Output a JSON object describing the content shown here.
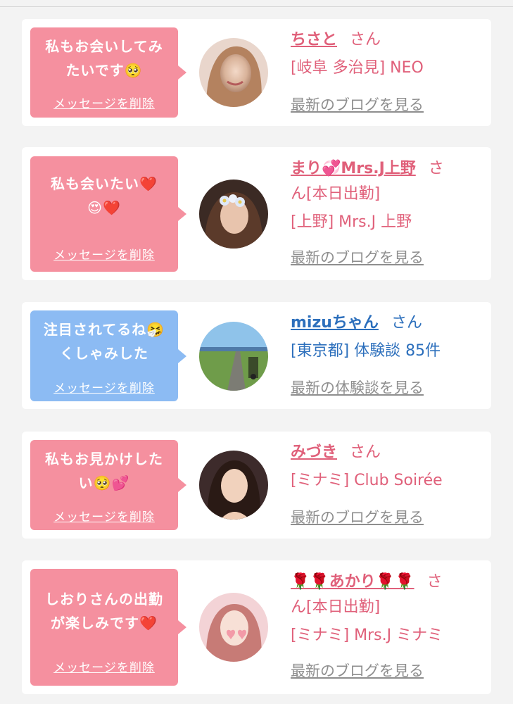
{
  "cards": [
    {
      "bubble_text": "私もお会いしてみ\nたいです🥺",
      "delete_label": "メッセージを削除",
      "name": "ちさと",
      "honorific": "さん",
      "name_suffix": "",
      "details": [
        "[岐阜 多治見] NEO"
      ],
      "link_label": "最新のブログを見る",
      "theme": "pink",
      "avatar_icon": "woman-portrait-avatar"
    },
    {
      "bubble_text": "私も会いたい❤️\n😍❤️",
      "delete_label": "メッセージを削除",
      "name": "まり💞Mrs.J上野",
      "honorific": "さ",
      "name_suffix": "ん[本日出勤]",
      "details": [
        "[上野] Mrs.J 上野"
      ],
      "link_label": "最新のブログを見る",
      "theme": "pink",
      "avatar_icon": "woman-flowers-avatar"
    },
    {
      "bubble_text": "注目されてるね🤧\nくしゃみした",
      "delete_label": "メッセージを削除",
      "name": "mizuちゃん",
      "honorific": "さん",
      "name_suffix": "",
      "details": [
        "[東京都] 体験談 85件"
      ],
      "link_label": "最新の体験談を見る",
      "theme": "blue",
      "avatar_icon": "road-landscape-avatar"
    },
    {
      "bubble_text": "私もお見かけした\nい🥺💕",
      "delete_label": "メッセージを削除",
      "name": "みづき",
      "honorific": "さん",
      "name_suffix": "",
      "details": [
        "[ミナミ] Club Soirée"
      ],
      "link_label": "最新のブログを見る",
      "theme": "pink",
      "avatar_icon": "woman-dark-avatar"
    },
    {
      "bubble_text": "しおりさんの出勤\nが楽しみです❤️",
      "delete_label": "メッセージを削除",
      "name": "🌹🌹あかり🌹🌹",
      "honorific": "さ",
      "name_suffix": "ん[本日出勤]",
      "details": [
        "[ミナミ] Mrs.J ミナミ"
      ],
      "link_label": "最新のブログを見る",
      "theme": "pink",
      "avatar_icon": "woman-hearts-avatar"
    }
  ],
  "colors": {
    "pink_bubble": "#f5909f",
    "blue_bubble": "#8cbbf3",
    "pink_text": "#e0607a",
    "blue_text": "#2c6fbc",
    "link_gray": "#8e8e8e",
    "background": "#f3f3f3"
  }
}
